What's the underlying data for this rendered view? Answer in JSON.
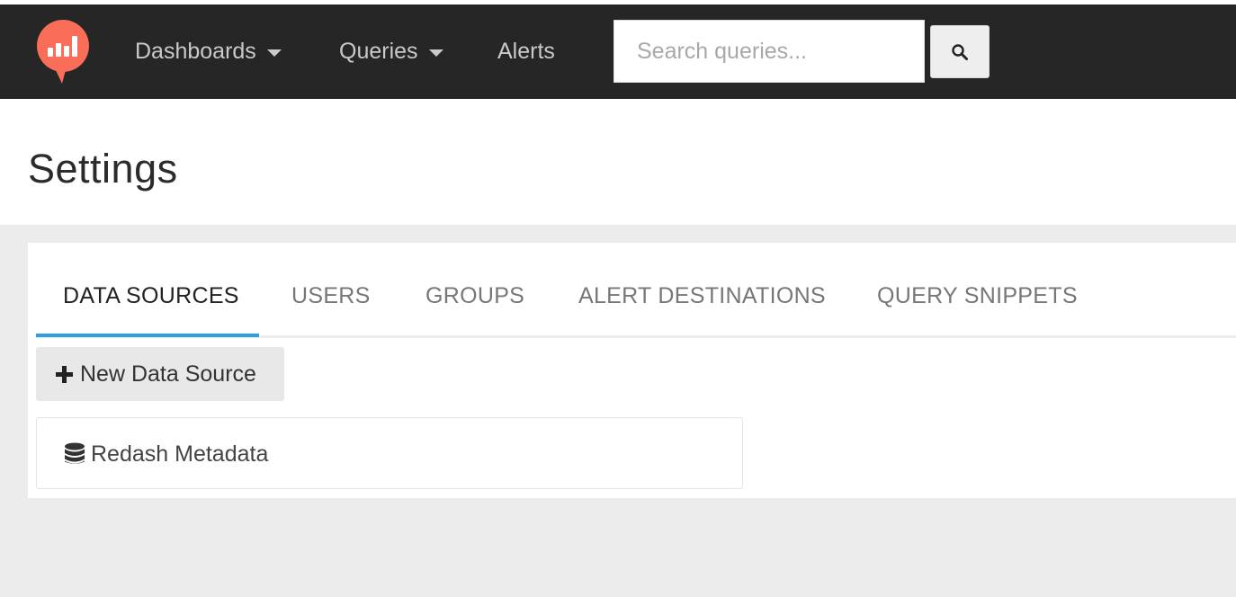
{
  "app": {
    "logo_icon": "redash-logo-icon",
    "brand_color": "#f96d59"
  },
  "navbar": {
    "background": "#262626",
    "items": [
      {
        "label": "Dashboards",
        "has_dropdown": true
      },
      {
        "label": "Queries",
        "has_dropdown": true
      },
      {
        "label": "Alerts",
        "has_dropdown": false
      }
    ],
    "search": {
      "placeholder": "Search queries...",
      "value": "",
      "button_icon": "search-icon"
    }
  },
  "page": {
    "title": "Settings"
  },
  "settings": {
    "tabs": [
      {
        "label": "DATA SOURCES",
        "active": true
      },
      {
        "label": "USERS",
        "active": false
      },
      {
        "label": "GROUPS",
        "active": false
      },
      {
        "label": "ALERT DESTINATIONS",
        "active": false
      },
      {
        "label": "QUERY SNIPPETS",
        "active": false
      }
    ],
    "accent_color": "#2d9fe0",
    "new_button": {
      "icon": "plus-icon",
      "label": "New Data Source"
    },
    "data_sources": [
      {
        "icon": "database-icon",
        "name": "Redash Metadata"
      }
    ]
  }
}
